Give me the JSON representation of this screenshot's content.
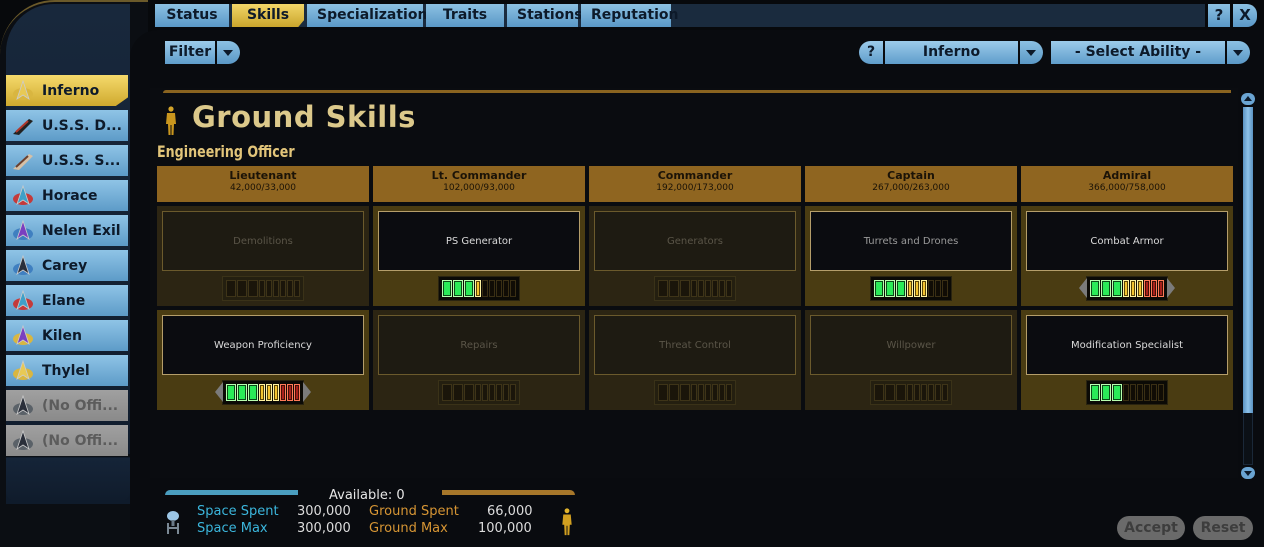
{
  "tabs": [
    {
      "label": "Status",
      "active": false
    },
    {
      "label": "Skills",
      "active": true
    },
    {
      "label": "Specializations",
      "active": false
    },
    {
      "label": "Traits",
      "active": false
    },
    {
      "label": "Stations",
      "active": false
    },
    {
      "label": "Reputation",
      "active": false
    }
  ],
  "window_buttons": {
    "help": "?",
    "close": "X"
  },
  "toolbar": {
    "filter_label": "Filter",
    "help_label": "?",
    "officer_select": "Inferno",
    "ability_select": "- Select Ability -"
  },
  "officers": [
    {
      "name": "Inferno",
      "icon": "commbadge-gold-icon",
      "state": "active"
    },
    {
      "name": "U.S.S. D...",
      "icon": "starship-icon",
      "state": "normal"
    },
    {
      "name": "U.S.S. S...",
      "icon": "shuttle-icon",
      "state": "normal"
    },
    {
      "name": "Horace",
      "icon": "commbadge-red-icon",
      "state": "normal"
    },
    {
      "name": "Nelen Exil",
      "icon": "commbadge-purple-icon",
      "state": "normal"
    },
    {
      "name": "Carey",
      "icon": "commbadge-blue-icon",
      "state": "normal"
    },
    {
      "name": "Elane",
      "icon": "commbadge-red-icon",
      "state": "normal"
    },
    {
      "name": "Kilen",
      "icon": "commbadge-purple-gold-icon",
      "state": "normal"
    },
    {
      "name": "Thylel",
      "icon": "commbadge-gold-icon",
      "state": "normal"
    },
    {
      "name": "(No Offi...",
      "icon": "commbadge-gray-icon",
      "state": "empty"
    },
    {
      "name": "(No Offi...",
      "icon": "commbadge-gray-icon",
      "state": "empty"
    }
  ],
  "section": {
    "title": "Ground Skills",
    "subtitle": "Engineering Officer"
  },
  "ranks": [
    {
      "name": "Lieutenant",
      "cost": "42,000/33,000"
    },
    {
      "name": "Lt. Commander",
      "cost": "102,000/93,000"
    },
    {
      "name": "Commander",
      "cost": "192,000/173,000"
    },
    {
      "name": "Captain",
      "cost": "267,000/263,000"
    },
    {
      "name": "Admiral",
      "cost": "366,000/758,000"
    }
  ],
  "skills": [
    [
      {
        "name": "Demolitions",
        "available": false,
        "level": 0,
        "max": 9
      },
      {
        "name": "PS Generator",
        "available": true,
        "level": 4,
        "max": 9
      },
      {
        "name": "Generators",
        "available": false,
        "level": 0,
        "max": 9
      },
      {
        "name": "Turrets and Drones",
        "available": true,
        "level": 6,
        "max": 9
      },
      {
        "name": "Combat Armor",
        "available": true,
        "level": 9,
        "max": 9,
        "arrows": true
      }
    ],
    [
      {
        "name": "Weapon Proficiency",
        "available": true,
        "level": 9,
        "max": 9,
        "arrows": true
      },
      {
        "name": "Repairs",
        "available": false,
        "level": 0,
        "max": 9
      },
      {
        "name": "Threat Control",
        "available": false,
        "level": 0,
        "max": 9
      },
      {
        "name": "Willpower",
        "available": false,
        "level": 0,
        "max": 9
      },
      {
        "name": "Modification Specialist",
        "available": true,
        "level": 3,
        "max": 9
      }
    ]
  ],
  "summary": {
    "available_label": "Available: 0",
    "space_spent_label": "Space Spent",
    "space_spent": "300,000",
    "space_max_label": "Space Max",
    "space_max": "300,000",
    "ground_spent_label": "Ground Spent",
    "ground_spent": "66,000",
    "ground_max_label": "Ground Max",
    "ground_max": "100,000"
  },
  "actions": {
    "accept": "Accept",
    "reset": "Reset"
  },
  "colors": {
    "tab_active": "#e6c447",
    "tab": "#7cb5dd",
    "rank_header": "#8f6520",
    "space_text": "#3bb6dc",
    "ground_text": "#d69534"
  }
}
